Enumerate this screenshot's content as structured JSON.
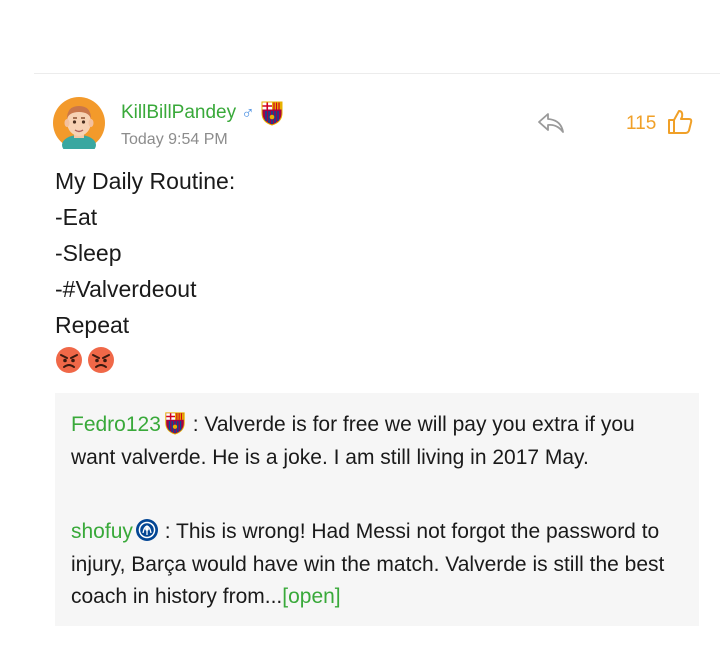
{
  "post": {
    "username": "KillBillPandey",
    "gender_symbol": "♂",
    "timestamp": "Today 9:54 PM",
    "like_count": "115",
    "body_lines": [
      "My Daily Routine:",
      "-Eat",
      "-Sleep",
      "-#Valverdeout",
      "Repeat"
    ],
    "emojis": [
      "angry-face-icon",
      "angry-face-icon"
    ],
    "badge_icon": "barcelona-crest-icon"
  },
  "comments": [
    {
      "username": "Fedro123",
      "badge_icon": "barcelona-crest-icon",
      "text": " : Valverde is for free we will pay you extra if you want valverde. He is a joke. I am still living in 2017 May."
    },
    {
      "username": "shofuy",
      "badge_icon": "chelsea-crest-icon",
      "text": " : This is wrong! Had Messi not forgot the password to injury, Barça would have win the match. Valverde is still the best coach in history from...",
      "more_link": "[open]"
    }
  ],
  "colors": {
    "username": "#39a93a",
    "like": "#f0a028",
    "gender": "#4a90e2",
    "timestamp": "#8c8c8c",
    "comment_bg": "#f6f6f6"
  }
}
